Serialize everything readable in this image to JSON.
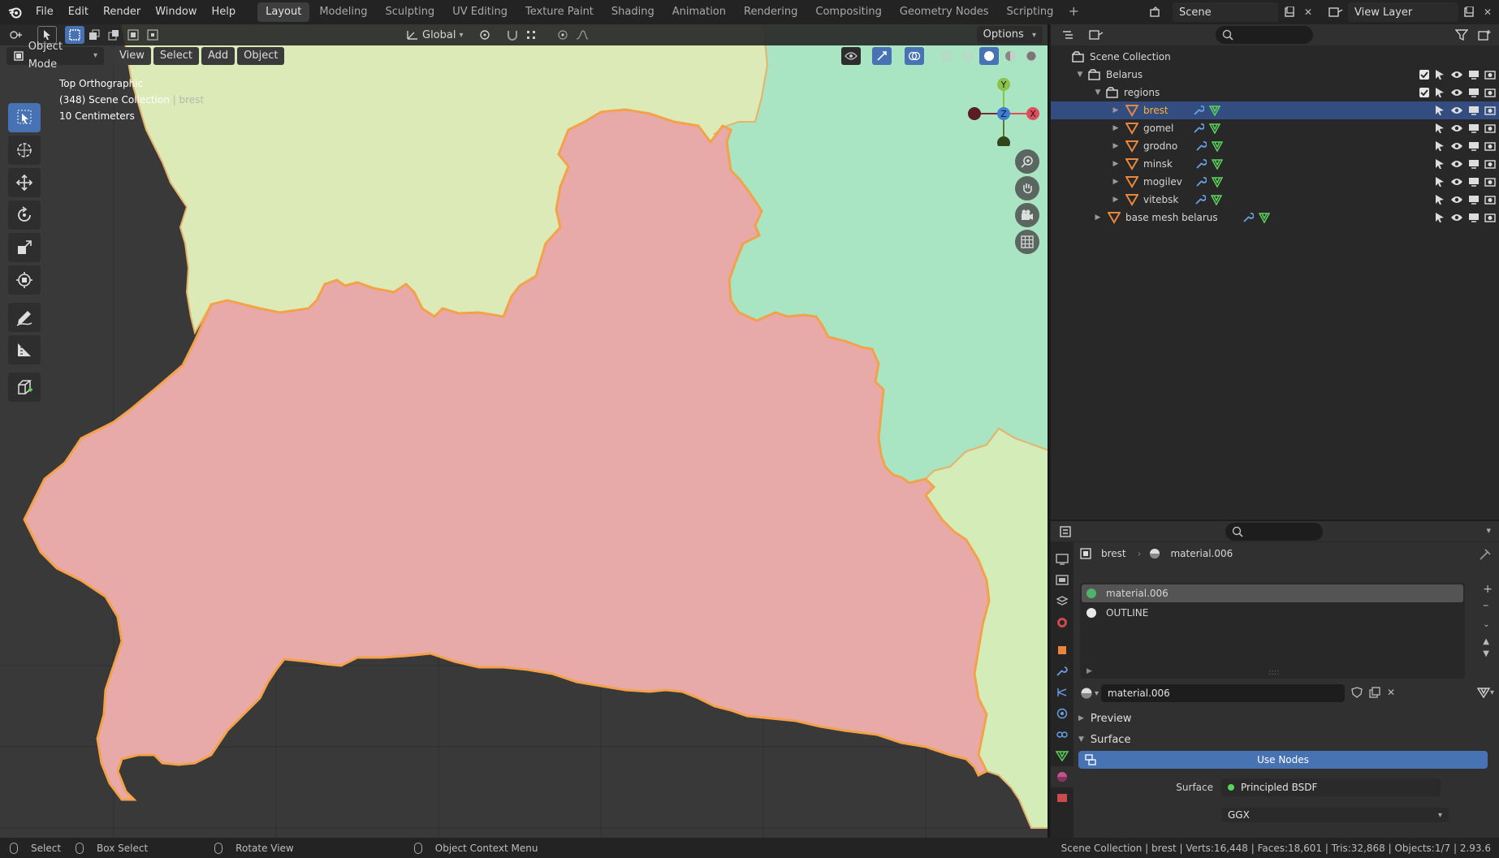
{
  "menu": [
    "File",
    "Edit",
    "Render",
    "Window",
    "Help"
  ],
  "workspaces": [
    {
      "label": "Layout",
      "active": true
    },
    {
      "label": "Modeling"
    },
    {
      "label": "Sculpting"
    },
    {
      "label": "UV Editing"
    },
    {
      "label": "Texture Paint"
    },
    {
      "label": "Shading"
    },
    {
      "label": "Animation"
    },
    {
      "label": "Rendering"
    },
    {
      "label": "Compositing"
    },
    {
      "label": "Geometry Nodes"
    },
    {
      "label": "Scripting"
    }
  ],
  "scene": {
    "label": "Scene"
  },
  "view_layer": {
    "label": "View Layer"
  },
  "viewport": {
    "transform_orientation": "Global",
    "options_label": "Options",
    "mode": "Object Mode",
    "menus": [
      "View",
      "Select",
      "Add",
      "Object"
    ],
    "info_view": "Top Orthographic",
    "info_collection": "(348) Scene Collection",
    "info_object": "brest",
    "info_scale": "10 Centimeters",
    "gizmo": {
      "y": "Y",
      "z": "Z",
      "x": "X"
    }
  },
  "outliner": {
    "root": "Scene Collection",
    "rows": [
      {
        "label": "Belarus",
        "type": "collection",
        "level": 1
      },
      {
        "label": "regions",
        "type": "collection",
        "level": 2
      },
      {
        "label": "brest",
        "type": "mesh",
        "level": 3,
        "selected": true
      },
      {
        "label": "gomel",
        "type": "mesh",
        "level": 3
      },
      {
        "label": "grodno",
        "type": "mesh",
        "level": 3
      },
      {
        "label": "minsk",
        "type": "mesh",
        "level": 3
      },
      {
        "label": "mogilev",
        "type": "mesh",
        "level": 3
      },
      {
        "label": "vitebsk",
        "type": "mesh",
        "level": 3
      },
      {
        "label": "base mesh belarus",
        "type": "mesh",
        "level": 2
      }
    ]
  },
  "properties": {
    "breadcrumb_object": "brest",
    "breadcrumb_material": "material.006",
    "materials": [
      {
        "label": "material.006",
        "color": "#4fb46a",
        "active": true
      },
      {
        "label": "OUTLINE",
        "color": "#e8e8e8"
      }
    ],
    "material_field": "material.006",
    "panel_preview": "Preview",
    "panel_surface": "Surface",
    "use_nodes": "Use Nodes",
    "surface_label": "Surface",
    "surface_value": "Principled BSDF",
    "distribution": "GGX"
  },
  "statusbar": {
    "select": "Select",
    "box_select": "Box Select",
    "rotate": "Rotate View",
    "context_menu": "Object Context Menu",
    "stats": "Scene Collection | brest | Verts:16,448 | Faces:18,601 | Tris:32,868 | Objects:1/7 | 2.93.6"
  },
  "colors": {
    "accent": "#4772b3",
    "selected_text": "#ffaf29",
    "region_brest": "#e8a9a9",
    "region_grodno": "#dbeab6",
    "region_minsk": "#a9e4c3",
    "region_gomel": "#d3ecb8",
    "outline": "#f4a24a"
  }
}
